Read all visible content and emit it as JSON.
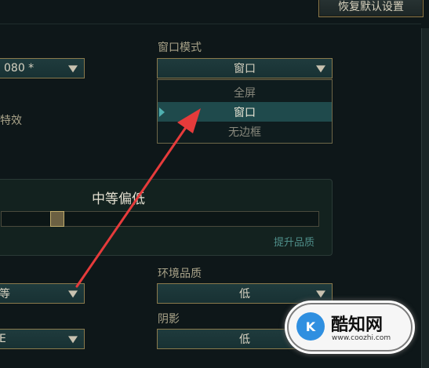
{
  "header": {
    "restore_defaults_label": "恢复默认设置"
  },
  "left_column": {
    "resolution_value": "080 *",
    "effects_label": "特效",
    "quality_value": "等",
    "bottom_value": "E"
  },
  "window_mode": {
    "label": "窗口模式",
    "selected_value": "窗口",
    "options": [
      "全屏",
      "窗口",
      "无边框"
    ],
    "selected_option": "窗口"
  },
  "graphics_panel": {
    "title": "中等偏低",
    "improve_quality_label": "提升品质",
    "slider_level": 0.07
  },
  "environment_quality": {
    "label": "环境品质",
    "value": "低"
  },
  "shadows": {
    "label": "阴影",
    "value": "低"
  },
  "watermark": {
    "brand": "酷知网",
    "url": "www.coozhi.com"
  },
  "colors": {
    "accent_gold": "#8a7a4c",
    "arrow_red": "#e63b3b",
    "highlight_teal": "#1f4a4c"
  }
}
